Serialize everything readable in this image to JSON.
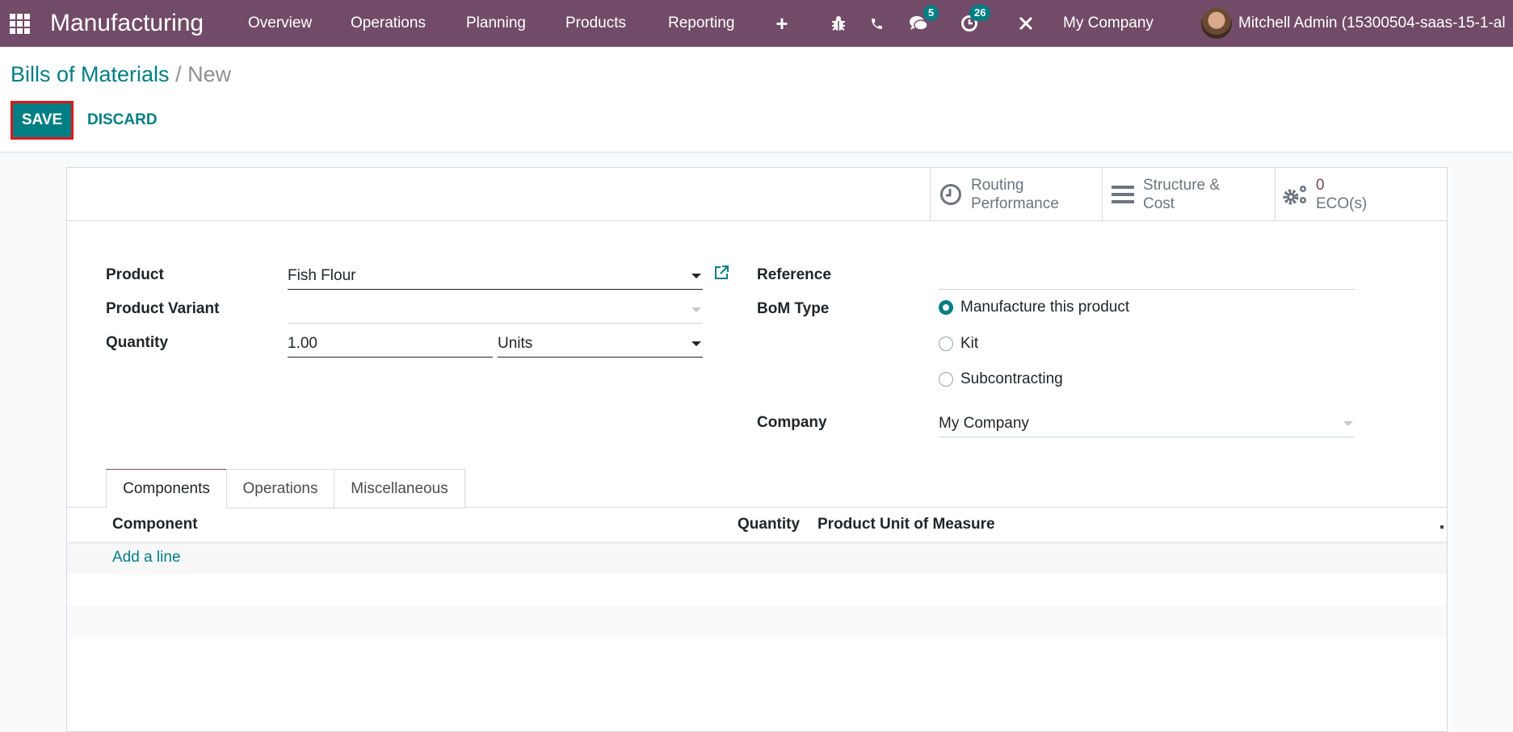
{
  "navbar": {
    "app_name": "Manufacturing",
    "menu": [
      "Overview",
      "Operations",
      "Planning",
      "Products",
      "Reporting"
    ],
    "messages_badge": "5",
    "activities_badge": "26",
    "company": "My Company",
    "user": "Mitchell Admin (15300504-saas-15-1-al"
  },
  "control_panel": {
    "breadcrumb_parent": "Bills of Materials",
    "breadcrumb_separator": "/",
    "breadcrumb_current": "New",
    "save_label": "SAVE",
    "discard_label": "DISCARD"
  },
  "button_box": {
    "routing_line1": "Routing",
    "routing_line2": "Performance",
    "structure_line1": "Structure &",
    "structure_line2": "Cost",
    "eco_count": "0",
    "eco_label": "ECO(s)"
  },
  "form": {
    "product_label": "Product",
    "product_value": "Fish Flour",
    "variant_label": "Product Variant",
    "variant_value": "",
    "quantity_label": "Quantity",
    "quantity_value": "1.00",
    "uom_value": "Units",
    "reference_label": "Reference",
    "reference_value": "",
    "bom_type_label": "BoM Type",
    "bom_type_options": [
      {
        "label": "Manufacture this product",
        "selected": true
      },
      {
        "label": "Kit",
        "selected": false
      },
      {
        "label": "Subcontracting",
        "selected": false
      }
    ],
    "company_label": "Company",
    "company_value": "My Company"
  },
  "tabs": [
    {
      "label": "Components",
      "active": true
    },
    {
      "label": "Operations",
      "active": false
    },
    {
      "label": "Miscellaneous",
      "active": false
    }
  ],
  "components_table": {
    "columns": [
      "Component",
      "Quantity",
      "Product Unit of Measure"
    ],
    "add_line": "Add a line"
  }
}
